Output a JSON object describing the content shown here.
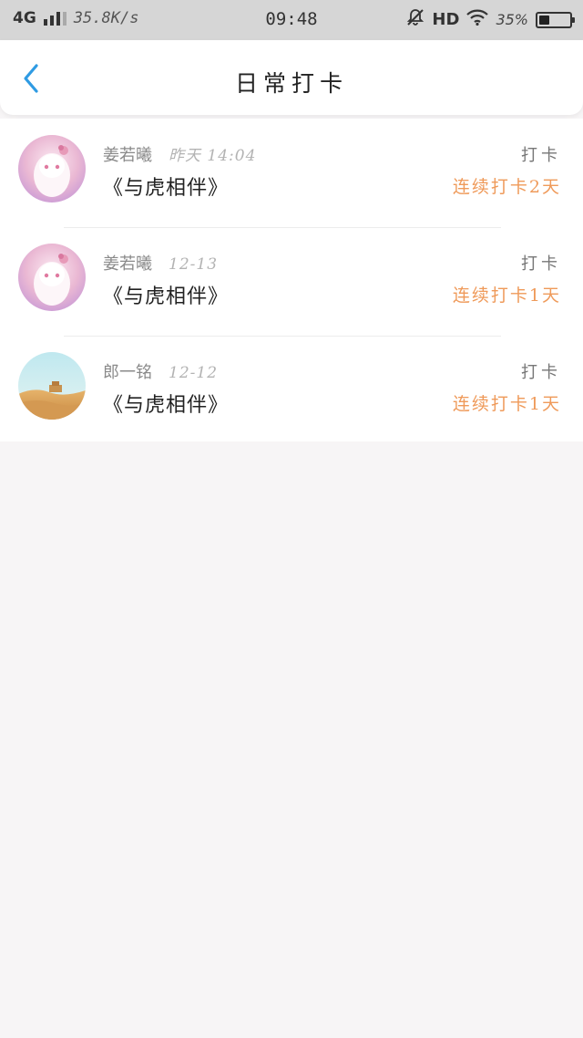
{
  "statusbar": {
    "network": "4G",
    "speed": "35.8K/s",
    "time": "09:48",
    "hd": "HD",
    "battery_text": "35%",
    "battery_level": 0.35,
    "signal_bars": 3
  },
  "nav": {
    "back_icon": "chevron-left-icon",
    "title": "日常打卡",
    "accent": "#2f9be3"
  },
  "checkins": [
    {
      "user": "姜若曦",
      "time": "昨天 14:04",
      "book": "《与虎相伴》",
      "type": "打卡",
      "streak": "连续打卡2天",
      "avatar": "anime-girl-avatar"
    },
    {
      "user": "姜若曦",
      "time": "12-13",
      "book": "《与虎相伴》",
      "type": "打卡",
      "streak": "连续打卡1天",
      "avatar": "anime-girl-avatar"
    },
    {
      "user": "郎一铭",
      "time": "12-12",
      "book": "《与虎相伴》",
      "type": "打卡",
      "streak": "连续打卡1天",
      "avatar": "desert-landscape-avatar"
    }
  ],
  "colors": {
    "streak": "#ef9a5a",
    "statusbar_bg": "#d6d6d6",
    "page_bg": "#f7f5f6"
  }
}
